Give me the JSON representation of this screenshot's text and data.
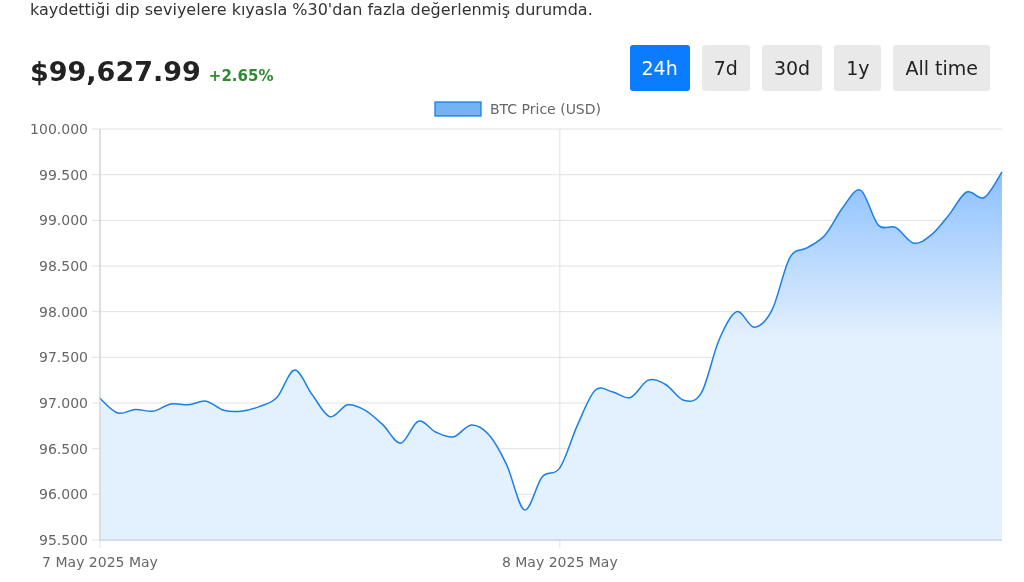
{
  "intro_text": "kaydettiği dip seviyelere kıyasla %30'dan fazla değerlenmiş durumda.",
  "price": "$99,627.99",
  "change": "+2.65%",
  "ranges": [
    {
      "label": "24h",
      "selected": true
    },
    {
      "label": "7d",
      "selected": false
    },
    {
      "label": "30d",
      "selected": false
    },
    {
      "label": "1y",
      "selected": false
    },
    {
      "label": "All time",
      "selected": false
    }
  ],
  "chart": {
    "chart_data": {
      "type": "area",
      "categories": [
        "7 May 2025 May",
        null,
        null,
        null,
        null,
        null,
        null,
        null,
        null,
        null,
        null,
        null,
        null,
        null,
        null,
        null,
        null,
        null,
        null,
        null,
        null,
        null,
        null,
        null,
        null,
        null,
        "8 May 2025 May",
        null,
        null,
        null,
        null,
        null,
        null,
        null,
        null,
        null,
        null,
        null,
        null,
        null,
        null,
        null,
        null,
        null,
        null,
        null,
        null,
        null,
        null,
        null,
        null,
        null
      ],
      "series": [
        {
          "name": "BTC Price (USD)",
          "color": "#1a7fe8",
          "values": [
            97.05,
            96.89,
            96.93,
            96.91,
            96.99,
            96.98,
            97.02,
            96.92,
            96.91,
            96.96,
            97.06,
            97.36,
            97.09,
            96.85,
            96.98,
            96.92,
            96.76,
            96.56,
            96.8,
            96.68,
            96.63,
            96.76,
            96.65,
            96.32,
            95.83,
            96.19,
            96.29,
            96.76,
            97.14,
            97.12,
            97.06,
            97.25,
            97.2,
            97.03,
            97.11,
            97.69,
            98,
            97.83,
            98.02,
            98.59,
            98.7,
            98.84,
            99.14,
            99.33,
            98.95,
            98.92,
            98.75,
            98.84,
            99.06,
            99.31,
            99.25,
            99.53
          ]
        }
      ],
      "ylim": [
        95.5,
        100
      ],
      "grid": true,
      "yticks": [
        {
          "value": 95.5,
          "label": "95.500"
        },
        {
          "value": 96,
          "label": "96.000"
        },
        {
          "value": 96.5,
          "label": "96.500"
        },
        {
          "value": 97,
          "label": "97.000"
        },
        {
          "value": 97.5,
          "label": "97.500"
        },
        {
          "value": 98,
          "label": "98.000"
        },
        {
          "value": 98.5,
          "label": "98.500"
        },
        {
          "value": 99,
          "label": "99.000"
        },
        {
          "value": 99.5,
          "label": "99.500"
        },
        {
          "value": 100,
          "label": "100.000"
        }
      ]
    }
  }
}
